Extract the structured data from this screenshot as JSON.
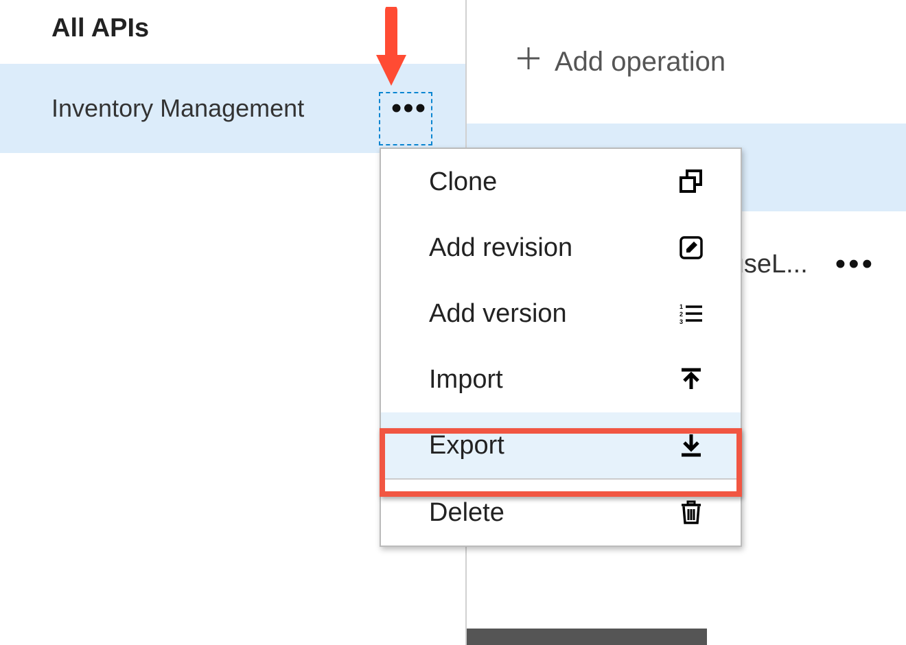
{
  "left": {
    "header": "All APIs",
    "selected_api": "Inventory Management"
  },
  "right": {
    "add_operation_label": "Add operation",
    "operation_name": "useL..."
  },
  "context_menu": {
    "items": [
      {
        "label": "Clone",
        "icon": "clone-icon"
      },
      {
        "label": "Add revision",
        "icon": "edit-icon"
      },
      {
        "label": "Add version",
        "icon": "list-icon"
      },
      {
        "label": "Import",
        "icon": "import-icon"
      },
      {
        "label": "Export",
        "icon": "export-icon",
        "hovered": true
      },
      {
        "divider": true
      },
      {
        "label": "Delete",
        "icon": "trash-icon"
      }
    ]
  },
  "annotations": {
    "arrow_color": "#ff4b33",
    "highlight_color": "#f15642"
  }
}
